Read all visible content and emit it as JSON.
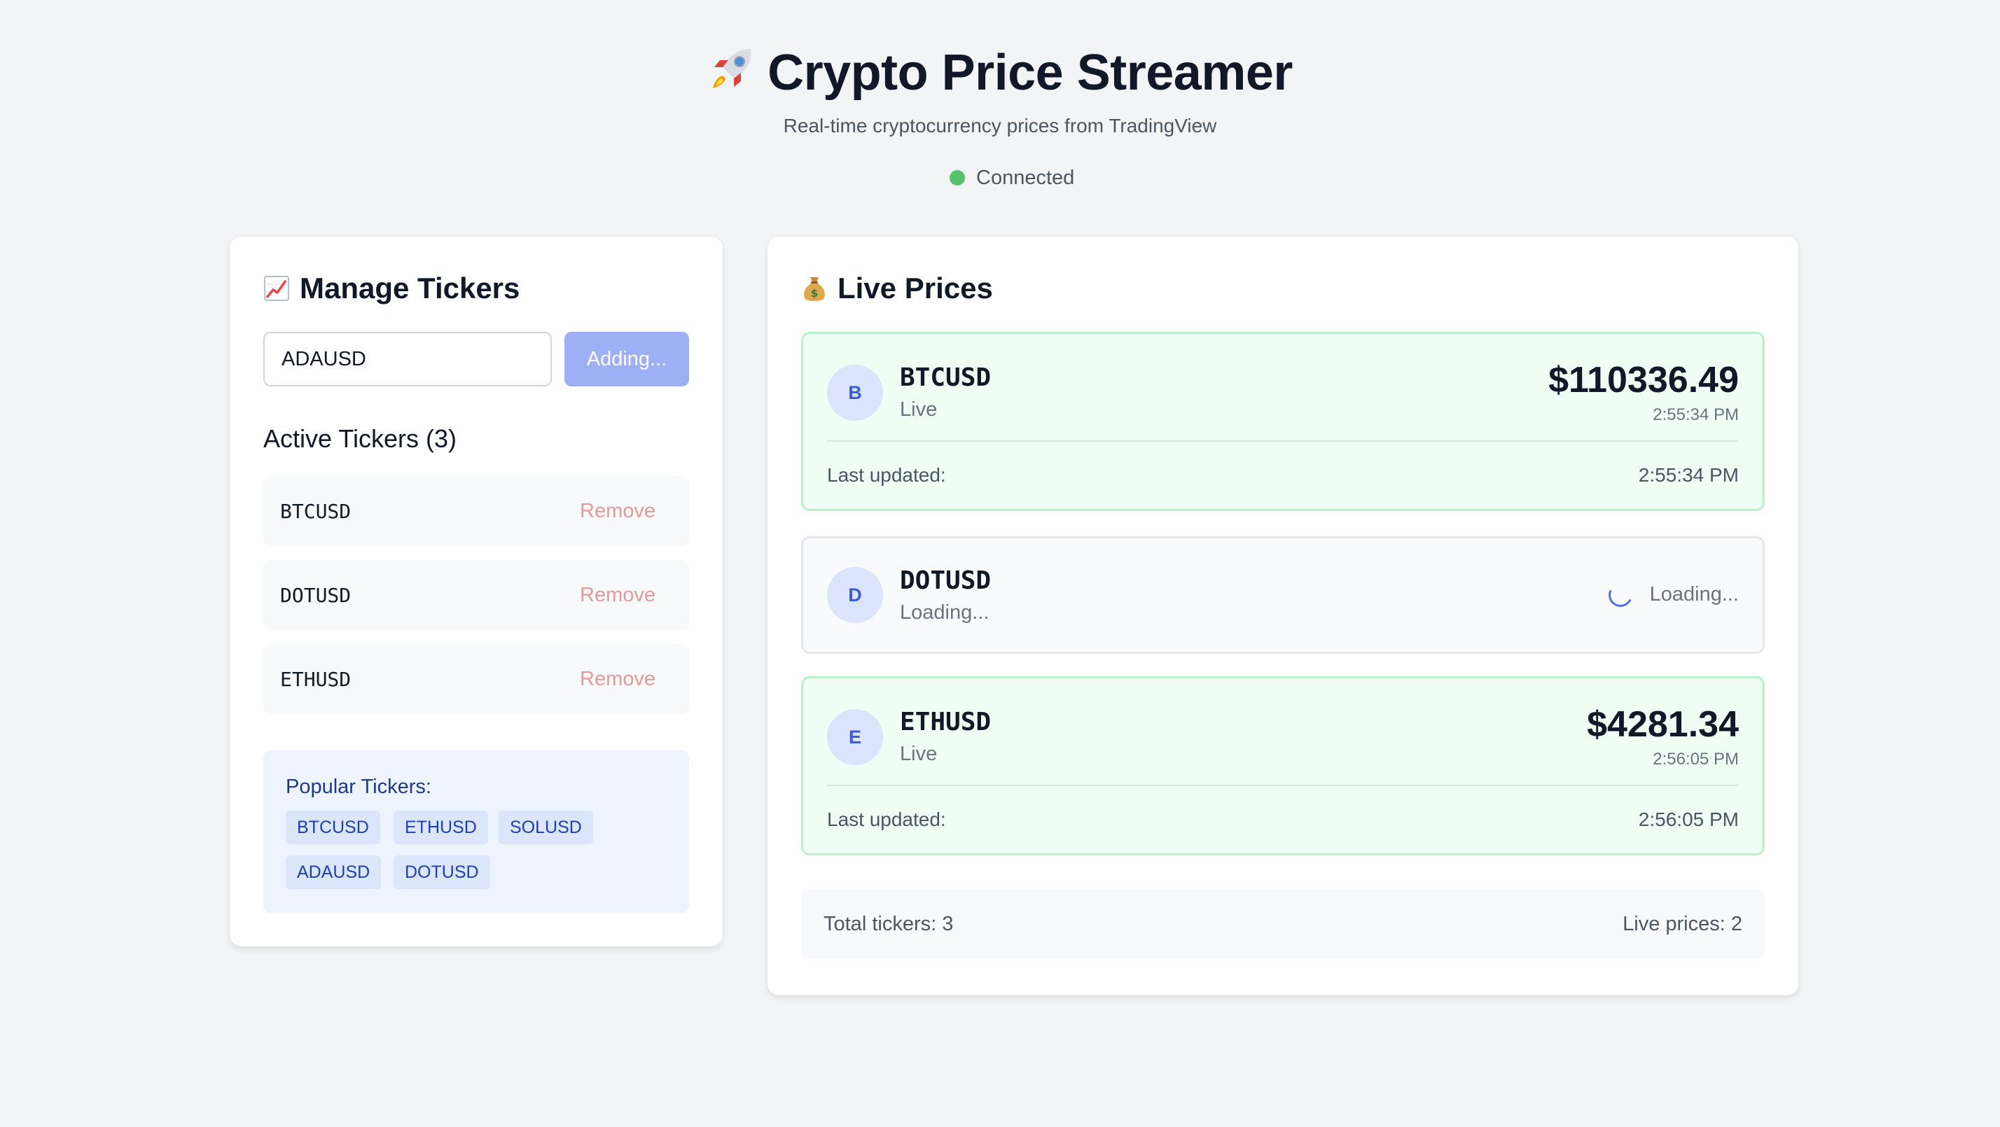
{
  "header": {
    "title": "Crypto Price Streamer",
    "subtitle": "Real-time cryptocurrency prices from TradingView",
    "status": "Connected",
    "status_color": "#56c26a"
  },
  "manage": {
    "title": "Manage Tickers",
    "input_value": "ADAUSD",
    "add_button": "Adding...",
    "active_title": "Active Tickers (3)",
    "active": [
      {
        "symbol": "BTCUSD",
        "action": "Remove"
      },
      {
        "symbol": "DOTUSD",
        "action": "Remove"
      },
      {
        "symbol": "ETHUSD",
        "action": "Remove"
      }
    ],
    "popular_label": "Popular Tickers:",
    "popular": [
      "BTCUSD",
      "ETHUSD",
      "SOLUSD",
      "ADAUSD",
      "DOTUSD"
    ]
  },
  "live": {
    "title": "Live Prices",
    "cards": [
      {
        "initial": "B",
        "symbol": "BTCUSD",
        "state": "Live",
        "price": "$110336.49",
        "time": "2:55:34 PM",
        "updated_label": "Last updated:",
        "updated_time": "2:55:34 PM"
      },
      {
        "initial": "D",
        "symbol": "DOTUSD",
        "state": "Loading...",
        "loading_text": "Loading..."
      },
      {
        "initial": "E",
        "symbol": "ETHUSD",
        "state": "Live",
        "price": "$4281.34",
        "time": "2:56:05 PM",
        "updated_label": "Last updated:",
        "updated_time": "2:56:05 PM"
      }
    ],
    "summary": {
      "total": "Total tickers: 3",
      "live": "Live prices: 2"
    }
  },
  "icons": {
    "title": "rocket-icon",
    "manage": "chart-increasing-icon",
    "live": "money-bag-icon"
  }
}
